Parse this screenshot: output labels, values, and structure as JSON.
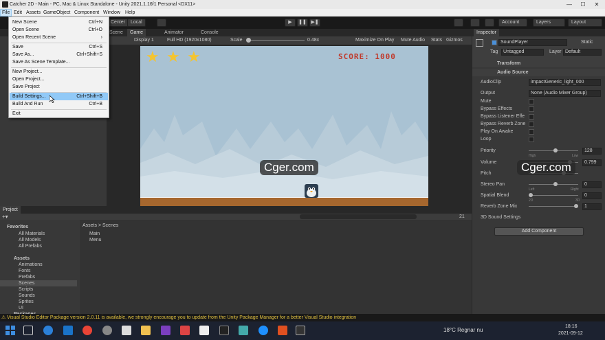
{
  "window": {
    "title": "Catcher 2D - Main - PC, Mac & Linux Standalone - Unity 2021.1.16f1 Personal <DX11>",
    "minimize": "—",
    "maximize": "☐",
    "close": "✕"
  },
  "menubar": [
    "File",
    "Edit",
    "Assets",
    "GameObject",
    "Component",
    "Window",
    "Help"
  ],
  "file_menu": [
    {
      "label": "New Scene",
      "shortcut": "Ctrl+N"
    },
    {
      "label": "Open Scene",
      "shortcut": "Ctrl+O"
    },
    {
      "label": "Open Recent Scene",
      "shortcut": "›"
    },
    {
      "label": "Save",
      "shortcut": "Ctrl+S"
    },
    {
      "label": "Save As...",
      "shortcut": "Ctrl+Shift+S"
    },
    {
      "label": "Save As Scene Template...",
      "shortcut": ""
    },
    {
      "label": "New Project...",
      "shortcut": ""
    },
    {
      "label": "Open Project...",
      "shortcut": ""
    },
    {
      "label": "Save Project",
      "shortcut": ""
    },
    {
      "label": "Build Settings...",
      "shortcut": "Ctrl+Shift+B"
    },
    {
      "label": "Build And Run",
      "shortcut": "Ctrl+B"
    },
    {
      "label": "Exit",
      "shortcut": ""
    }
  ],
  "toolbar": {
    "center": "Center",
    "local": "Local",
    "play": "▶",
    "pause": "❚❚",
    "step": "▶❚",
    "account": "Account",
    "layers": "Layers",
    "layout": "Layout"
  },
  "game_tabs": {
    "scene": "Scene",
    "game": "Game",
    "animator": "Animator",
    "console": "Console"
  },
  "game_bar": {
    "display": "Display 1",
    "resolution": "Full HD (1920x1080)",
    "scale_label": "Scale",
    "scale_value": "0.48x",
    "maximize": "Maximize On Play",
    "mute": "Mute Audio",
    "stats": "Stats",
    "gizmos": "Gizmos"
  },
  "game": {
    "score": "SCORE: 1000",
    "star": "★"
  },
  "watermark": "Cger.com",
  "project": {
    "tab": "Project",
    "favorites": "Favorites",
    "fav_items": [
      "All Materials",
      "All Models",
      "All Prefabs"
    ],
    "assets": "Assets",
    "asset_folders": [
      "Animations",
      "Fonts",
      "Prefabs",
      "Scenes",
      "Scripts",
      "Sounds",
      "Sprites",
      "UI"
    ],
    "packages": "Packages",
    "breadcrumb_root": "Assets",
    "breadcrumb_sep": ">",
    "breadcrumb_current": "Scenes",
    "files": [
      "Main",
      "Menu"
    ],
    "count": "21"
  },
  "inspector": {
    "tab": "Inspector",
    "object_name": "SoundPlayer",
    "static": "Static",
    "tag_label": "Tag",
    "tag_value": "Untagged",
    "layer_label": "Layer",
    "layer_value": "Default",
    "transform": "Transform",
    "audio_source": "Audio Source",
    "rows": {
      "audioclip_label": "AudioClip",
      "audioclip_value": "impactGeneric_light_000",
      "output_label": "Output",
      "output_value": "None (Audio Mixer Group)",
      "mute": "Mute",
      "bypass_effects": "Bypass Effects",
      "bypass_listener": "Bypass Listener Effe",
      "bypass_reverb": "Bypass Reverb Zone",
      "play_on_awake": "Play On Awake",
      "loop": "Loop",
      "priority_label": "Priority",
      "priority_value": "128",
      "priority_high": "High",
      "priority_low": "Low",
      "volume_label": "Volume",
      "volume_value": "0.799",
      "pitch_label": "Pitch",
      "stereo_label": "Stereo Pan",
      "stereo_value": "0",
      "stereo_left": "Left",
      "stereo_right": "Right",
      "spatial_label": "Spatial Blend",
      "spatial_value": "0",
      "spatial_2d": "2D",
      "spatial_3d": "3D",
      "reverb_label": "Reverb Zone Mix",
      "reverb_value": "1",
      "sound3d": "3D Sound Settings"
    },
    "add_component": "Add Component"
  },
  "status": "Visual Studio Editor Package version 2.0.11 is available, we strongly encourage you to update from the Unity Package Manager for a better Visual Studio integration",
  "taskbar": {
    "weather": "18°C  Regnar nu",
    "time": "18:16",
    "date": "2021-09-12"
  },
  "colors": {
    "game_sky": "#a9c2d3",
    "ground": "#a6672e",
    "score": "#c0392b",
    "star": "#f4c430",
    "menu_highlight": "#91c9f7",
    "status_text": "#e0c040"
  }
}
